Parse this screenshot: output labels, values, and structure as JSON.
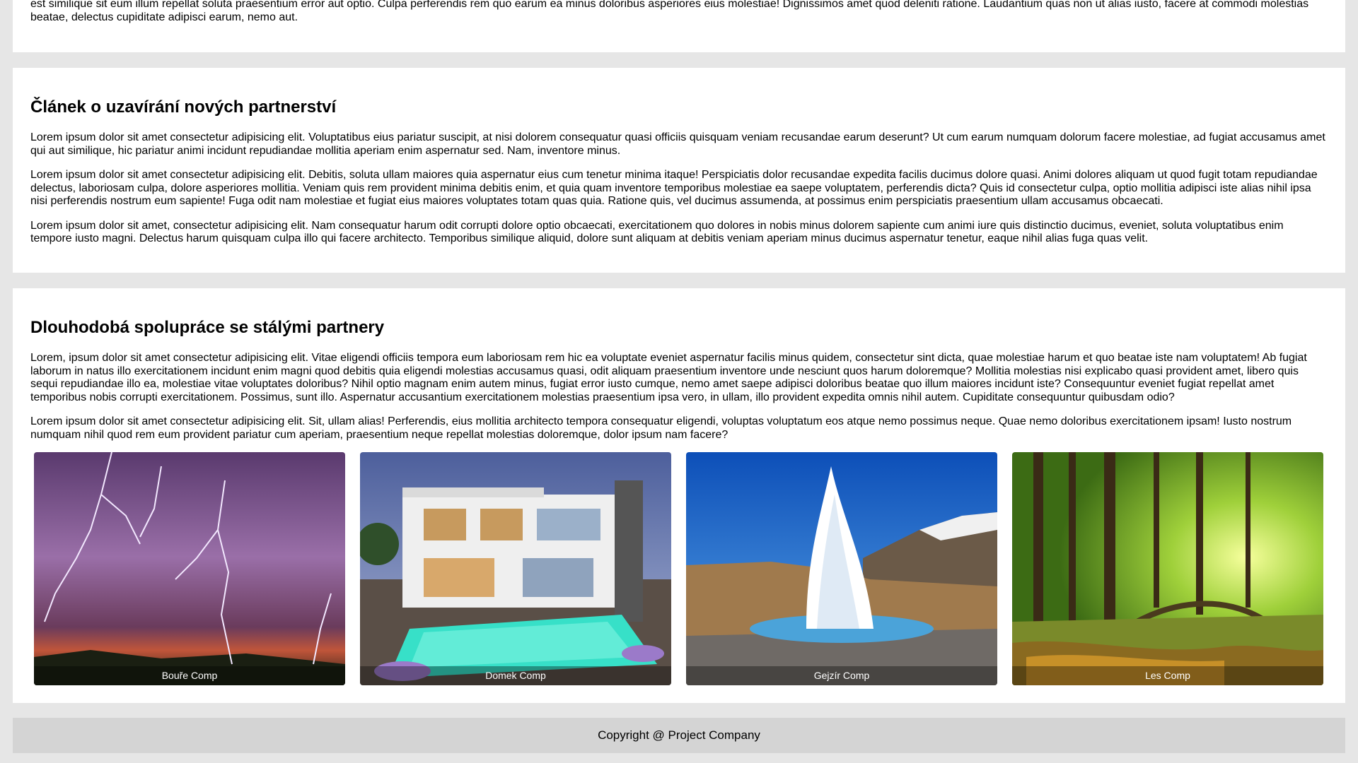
{
  "top_section": {
    "paragraph": "est similique sit eum illum repellat soluta praesentium error aut optio. Culpa perferendis rem quo earum ea minus doloribus asperiores eius molestiae! Dignissimos amet quod deleniti ratione. Laudantium quas non ut alias iusto, facere at commodi molestias beatae, delectus cupiditate adipisci earum, nemo aut."
  },
  "article1": {
    "title": "Článek o uzavírání nových partnerství",
    "paragraphs": [
      "Lorem ipsum dolor sit amet consectetur adipisicing elit. Voluptatibus eius pariatur suscipit, at nisi dolorem consequatur quasi officiis quisquam veniam recusandae earum deserunt? Ut cum earum numquam dolorum facere molestiae, ad fugiat accusamus amet qui aut similique, hic pariatur animi incidunt repudiandae mollitia aperiam enim aspernatur sed. Nam, inventore minus.",
      "Lorem ipsum dolor sit amet consectetur adipisicing elit. Debitis, soluta ullam maiores quia aspernatur eius cum tenetur minima itaque! Perspiciatis dolor recusandae expedita facilis ducimus dolore quasi. Animi dolores aliquam ut quod fugit totam repudiandae delectus, laboriosam culpa, dolore asperiores mollitia. Veniam quis rem provident minima debitis enim, et quia quam inventore temporibus molestiae ea saepe voluptatem, perferendis dicta? Quis id consectetur culpa, optio mollitia adipisci iste alias nihil ipsa nisi perferendis nostrum eum sapiente! Fuga odit nam molestiae et fugiat eius maiores voluptates totam quas quia. Ratione quis, vel ducimus assumenda, at possimus enim perspiciatis praesentium ullam accusamus obcaecati.",
      "Lorem ipsum dolor sit amet, consectetur adipisicing elit. Nam consequatur harum odit corrupti dolore optio obcaecati, exercitationem quo dolores in nobis minus dolorem sapiente cum animi iure quis distinctio ducimus, eveniet, soluta voluptatibus enim tempore iusto magni. Delectus harum quisquam culpa illo qui facere architecto. Temporibus similique aliquid, dolore sunt aliquam at debitis veniam aperiam minus ducimus aspernatur tenetur, eaque nihil alias fuga quas velit."
    ]
  },
  "article2": {
    "title": "Dlouhodobá spolupráce se stálými partnery",
    "paragraphs": [
      "Lorem, ipsum dolor sit amet consectetur adipisicing elit. Vitae eligendi officiis tempora eum laboriosam rem hic ea voluptate eveniet aspernatur facilis minus quidem, consectetur sint dicta, quae molestiae harum et quo beatae iste nam voluptatem! Ab fugiat laborum in natus illo exercitationem incidunt enim magni quod debitis quia eligendi molestias accusamus quasi, odit aliquam praesentium inventore unde nesciunt quos harum doloremque? Mollitia molestias nisi explicabo quasi provident amet, libero quis sequi repudiandae illo ea, molestiae vitae voluptates doloribus? Nihil optio magnam enim autem minus, fugiat error iusto cumque, nemo amet saepe adipisci doloribus beatae quo illum maiores incidunt iste? Consequuntur eveniet fugiat repellat amet temporibus nobis corrupti exercitationem. Possimus, sunt illo. Aspernatur accusantium exercitationem molestias praesentium ipsa vero, in ullam, illo provident expedita omnis nihil autem. Cupiditate consequuntur quibusdam odio?",
      "Lorem ipsum dolor sit amet consectetur adipisicing elit. Sit, ullam alias! Perferendis, eius mollitia architecto tempora consequatur eligendi, voluptas voluptatum eos atque nemo possimus neque. Quae nemo doloribus exercitationem ipsam! Iusto nostrum numquam nihil quod rem eum provident pariatur cum aperiam, praesentium neque repellat molestias doloremque, dolor ipsum nam facere?"
    ],
    "gallery": [
      {
        "caption": "Bouře Comp",
        "icon": "lightning-storm-image"
      },
      {
        "caption": "Domek Comp",
        "icon": "modern-house-image"
      },
      {
        "caption": "Gejzír Comp",
        "icon": "geyser-image"
      },
      {
        "caption": "Les Comp",
        "icon": "forest-image"
      }
    ]
  },
  "footer": {
    "text": "Copyright @ Project Company"
  }
}
